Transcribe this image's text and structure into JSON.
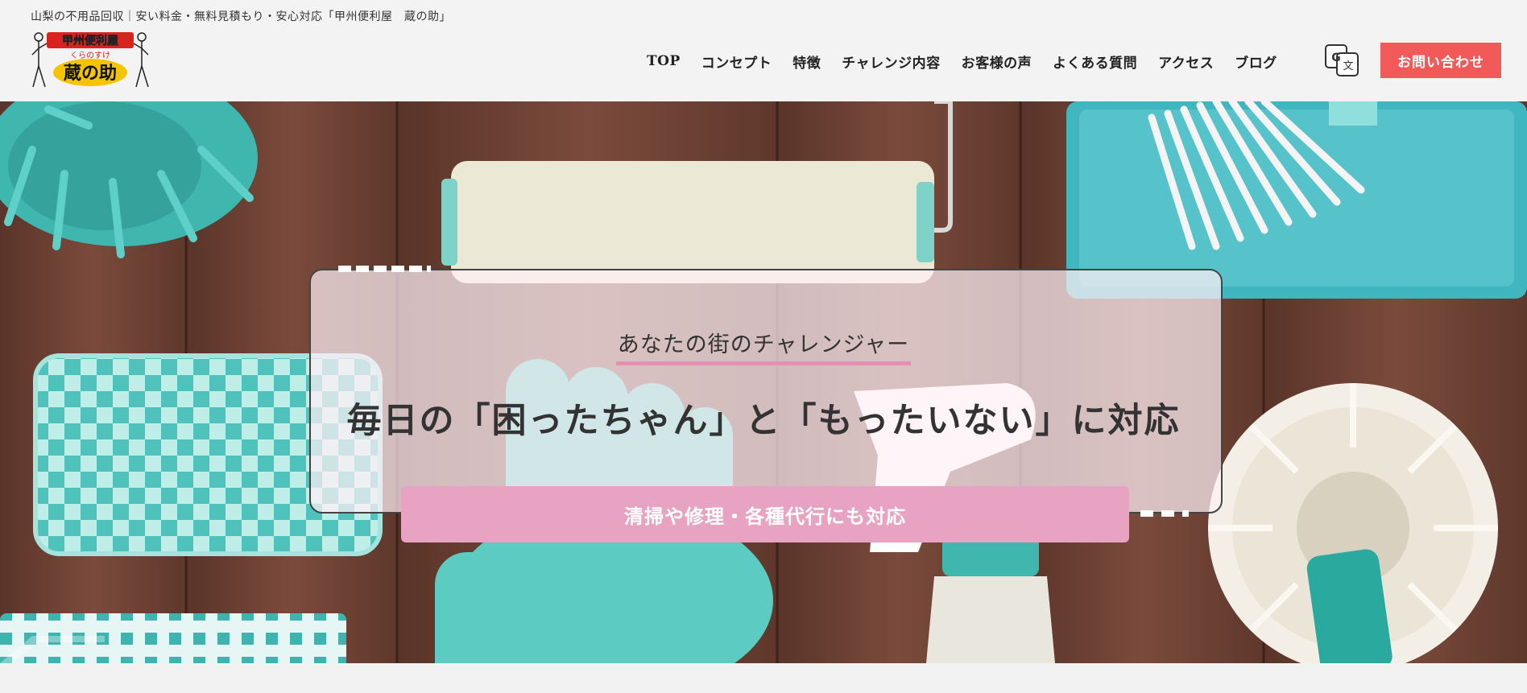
{
  "header": {
    "tagline": "山梨の不用品回収｜安い料金・無料見積もり・安心対応「甲州便利屋　蔵の助」",
    "logo": {
      "top_text": "甲州便利屋",
      "ruby": "くらのすけ",
      "main_text": "蔵の助"
    },
    "nav": [
      {
        "label": "TOP"
      },
      {
        "label": "コンセプト"
      },
      {
        "label": "特徴"
      },
      {
        "label": "チャレンジ内容"
      },
      {
        "label": "お客様の声"
      },
      {
        "label": "よくある質問"
      },
      {
        "label": "アクセス"
      },
      {
        "label": "ブログ"
      }
    ],
    "translate_icon": "google-translate-icon",
    "contact_label": "お問い合わせ"
  },
  "hero": {
    "sub_heading": "あなたの街のチャレンジャー",
    "main_heading": "毎日の「困ったちゃん」と「もったいない」に対応",
    "service_band": "清掃や修理・各種代行にも対応"
  },
  "colors": {
    "accent_red": "#f25a5a",
    "accent_pink": "#e7a3c1",
    "underline_pink": "#e58fb3",
    "wood_brown": "#6a4336",
    "teal": "#3db8b4"
  }
}
